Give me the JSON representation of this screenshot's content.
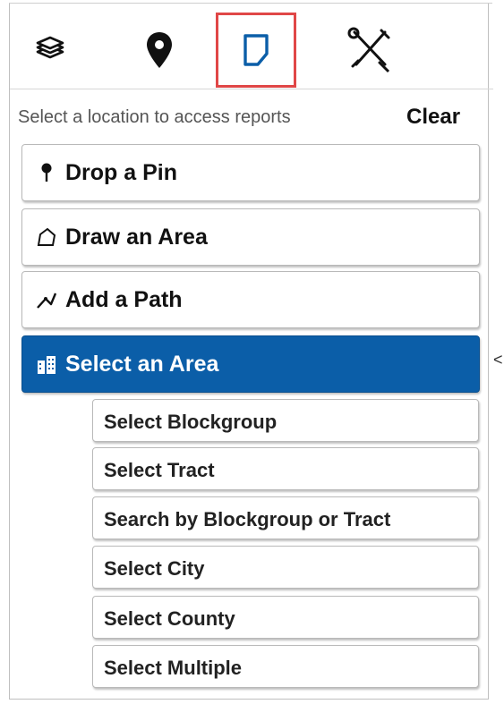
{
  "tabs": [
    {
      "name": "layers-icon"
    },
    {
      "name": "map-pin-icon"
    },
    {
      "name": "report-page-icon",
      "active": true
    },
    {
      "name": "tools-icon"
    }
  ],
  "header": {
    "hint": "Select a location to access reports",
    "clear_label": "Clear"
  },
  "tools": {
    "drop_pin": "Drop a Pin",
    "draw_area": "Draw an Area",
    "add_path": "Add a Path",
    "select_area": "Select an Area"
  },
  "sub_options": {
    "blockgroup": "Select Blockgroup",
    "tract": "Select Tract",
    "search": "Search by Blockgroup or Tract",
    "city": "Select City",
    "county": "Select County",
    "multiple": "Select Multiple"
  },
  "side_toggle": "<",
  "colors": {
    "active_bg": "#0b5ea8",
    "active_tab_border": "#e04747"
  }
}
